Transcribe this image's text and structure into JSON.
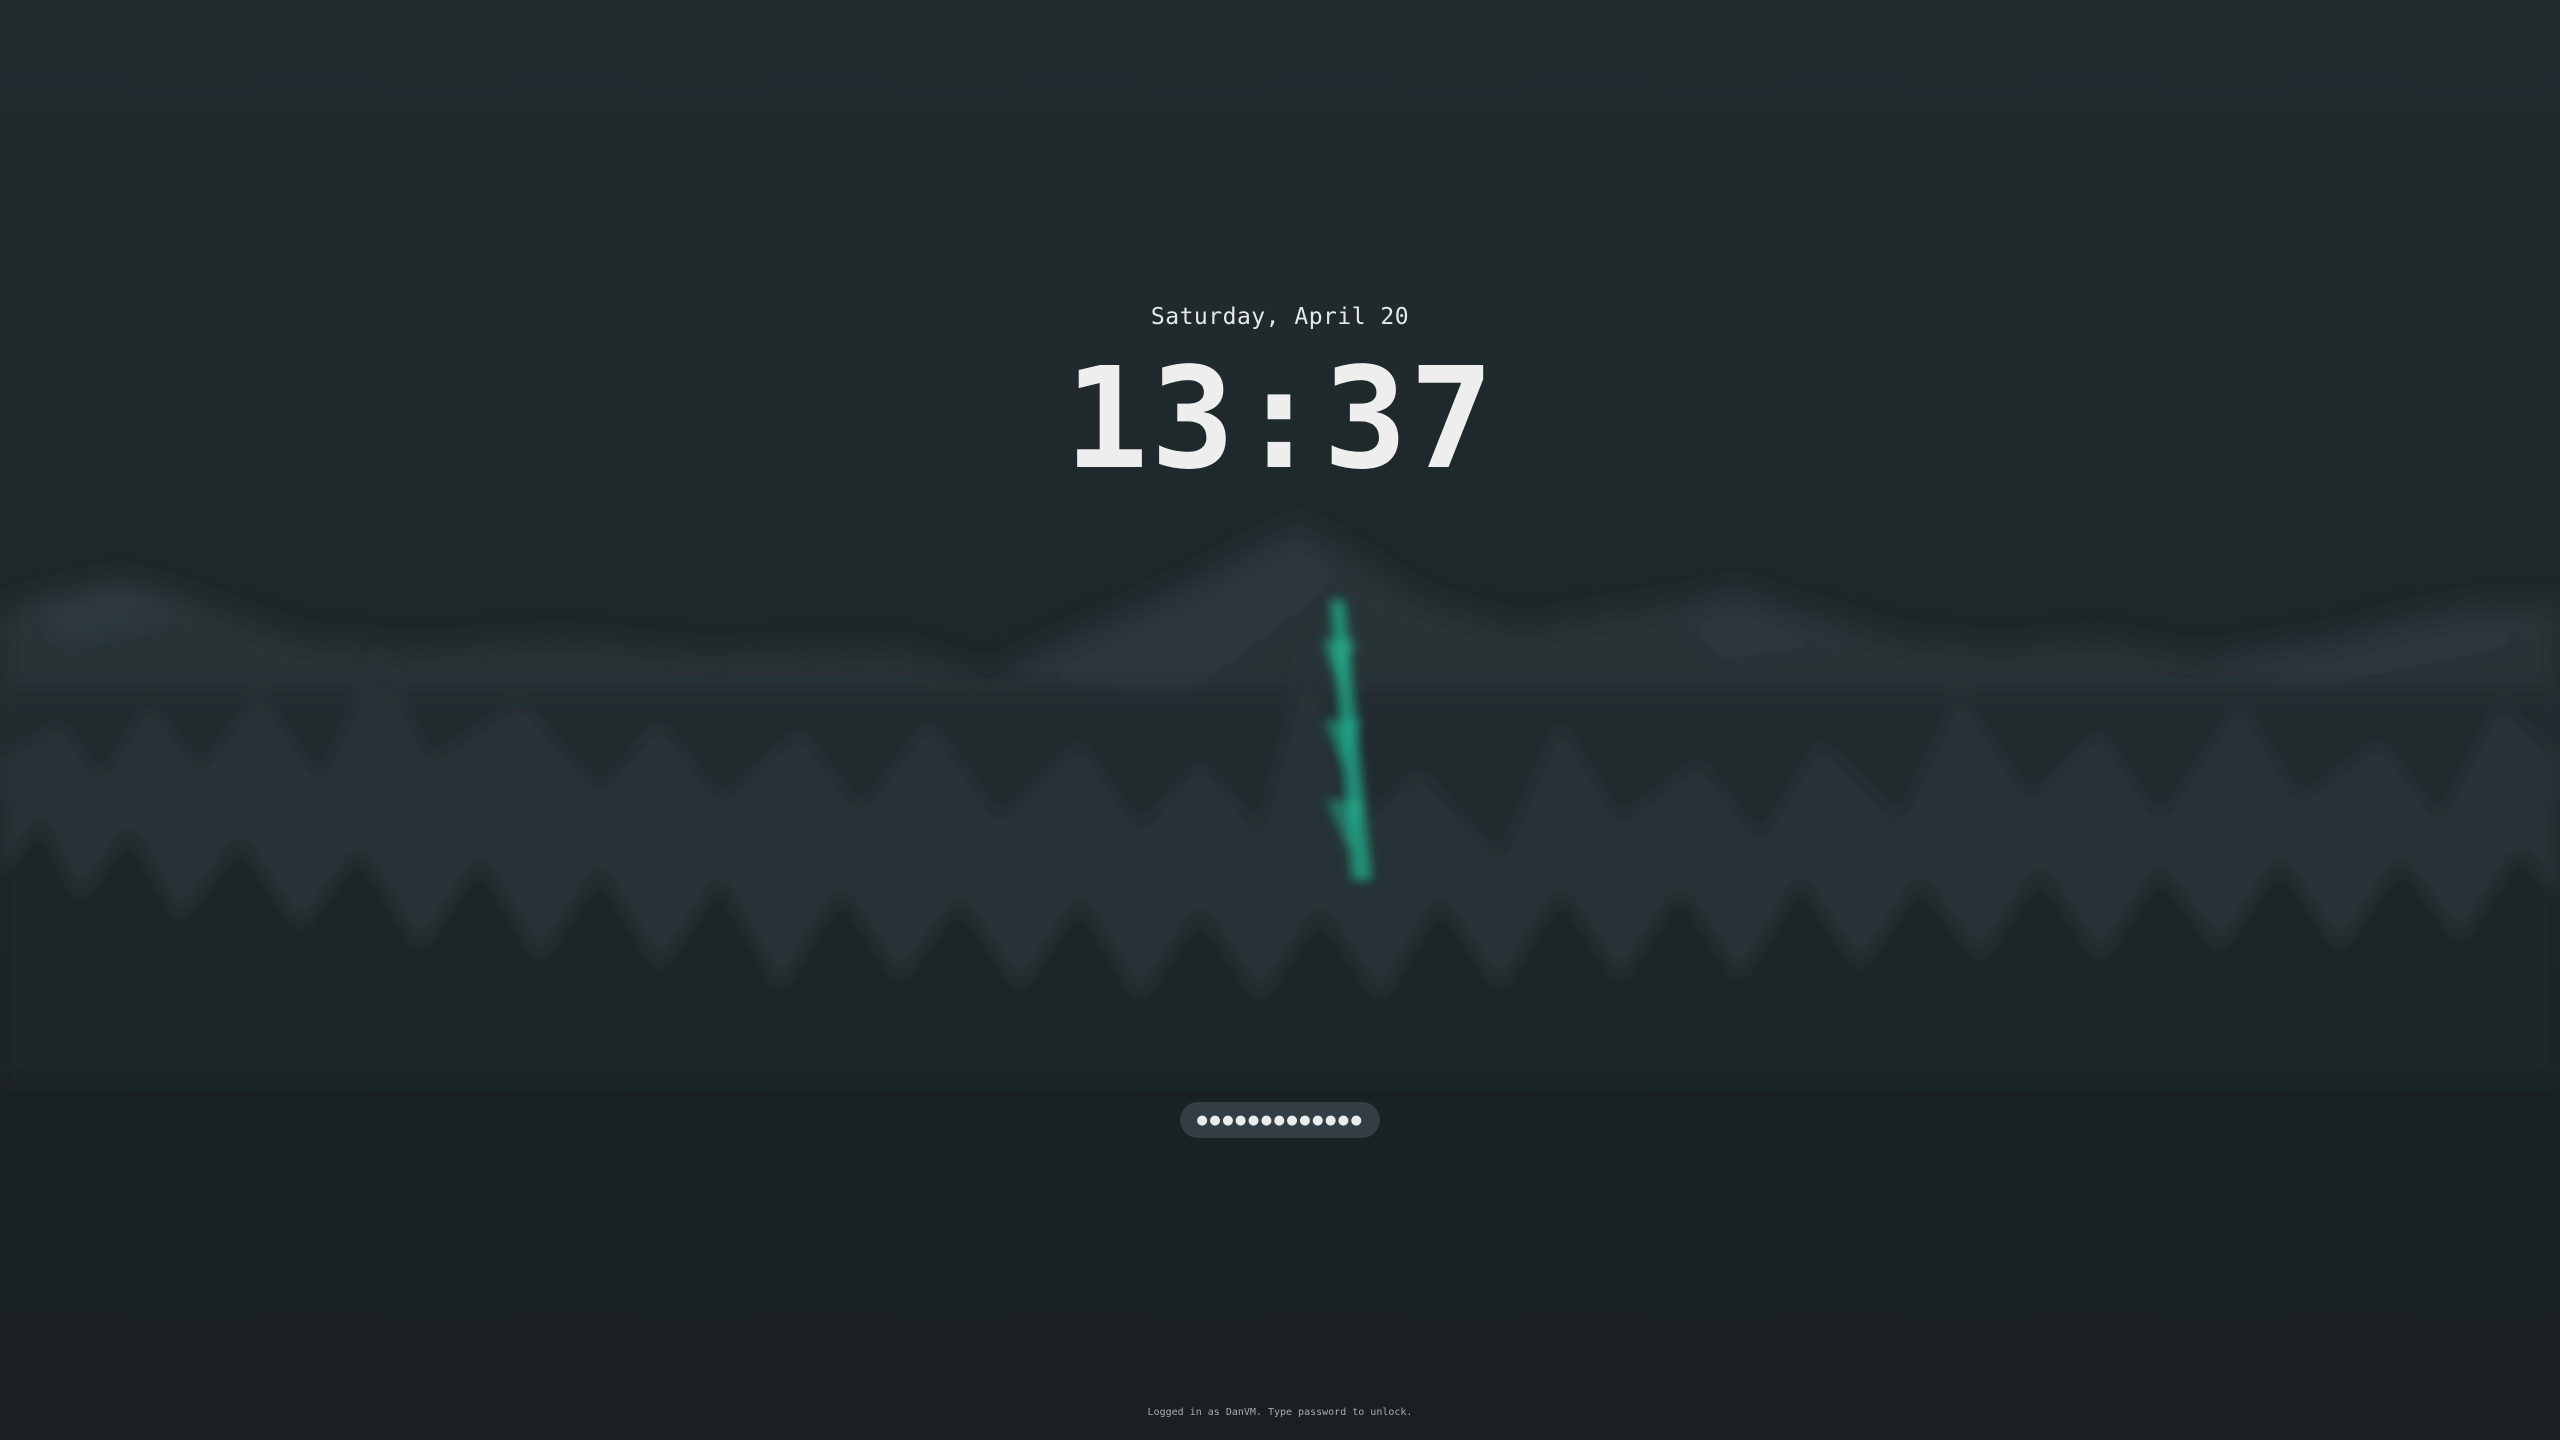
{
  "lockscreen": {
    "date": "Saturday, April 20",
    "time": "13:37",
    "password_mask": "●●●●●●●●●●●●●",
    "hint": "Logged in as DanVM. Type password to unlock."
  },
  "wallpaper": {
    "icon": "blurred-forest-mountain-wallpaper",
    "colors": {
      "background": "#1f292b",
      "mountains": "#2b353b",
      "trees": "#1a2123",
      "accent_tower": "#1f9e83"
    }
  },
  "colors": {
    "text": "#eeeeee",
    "pill": "#323e44",
    "hint": "#a7adae"
  }
}
